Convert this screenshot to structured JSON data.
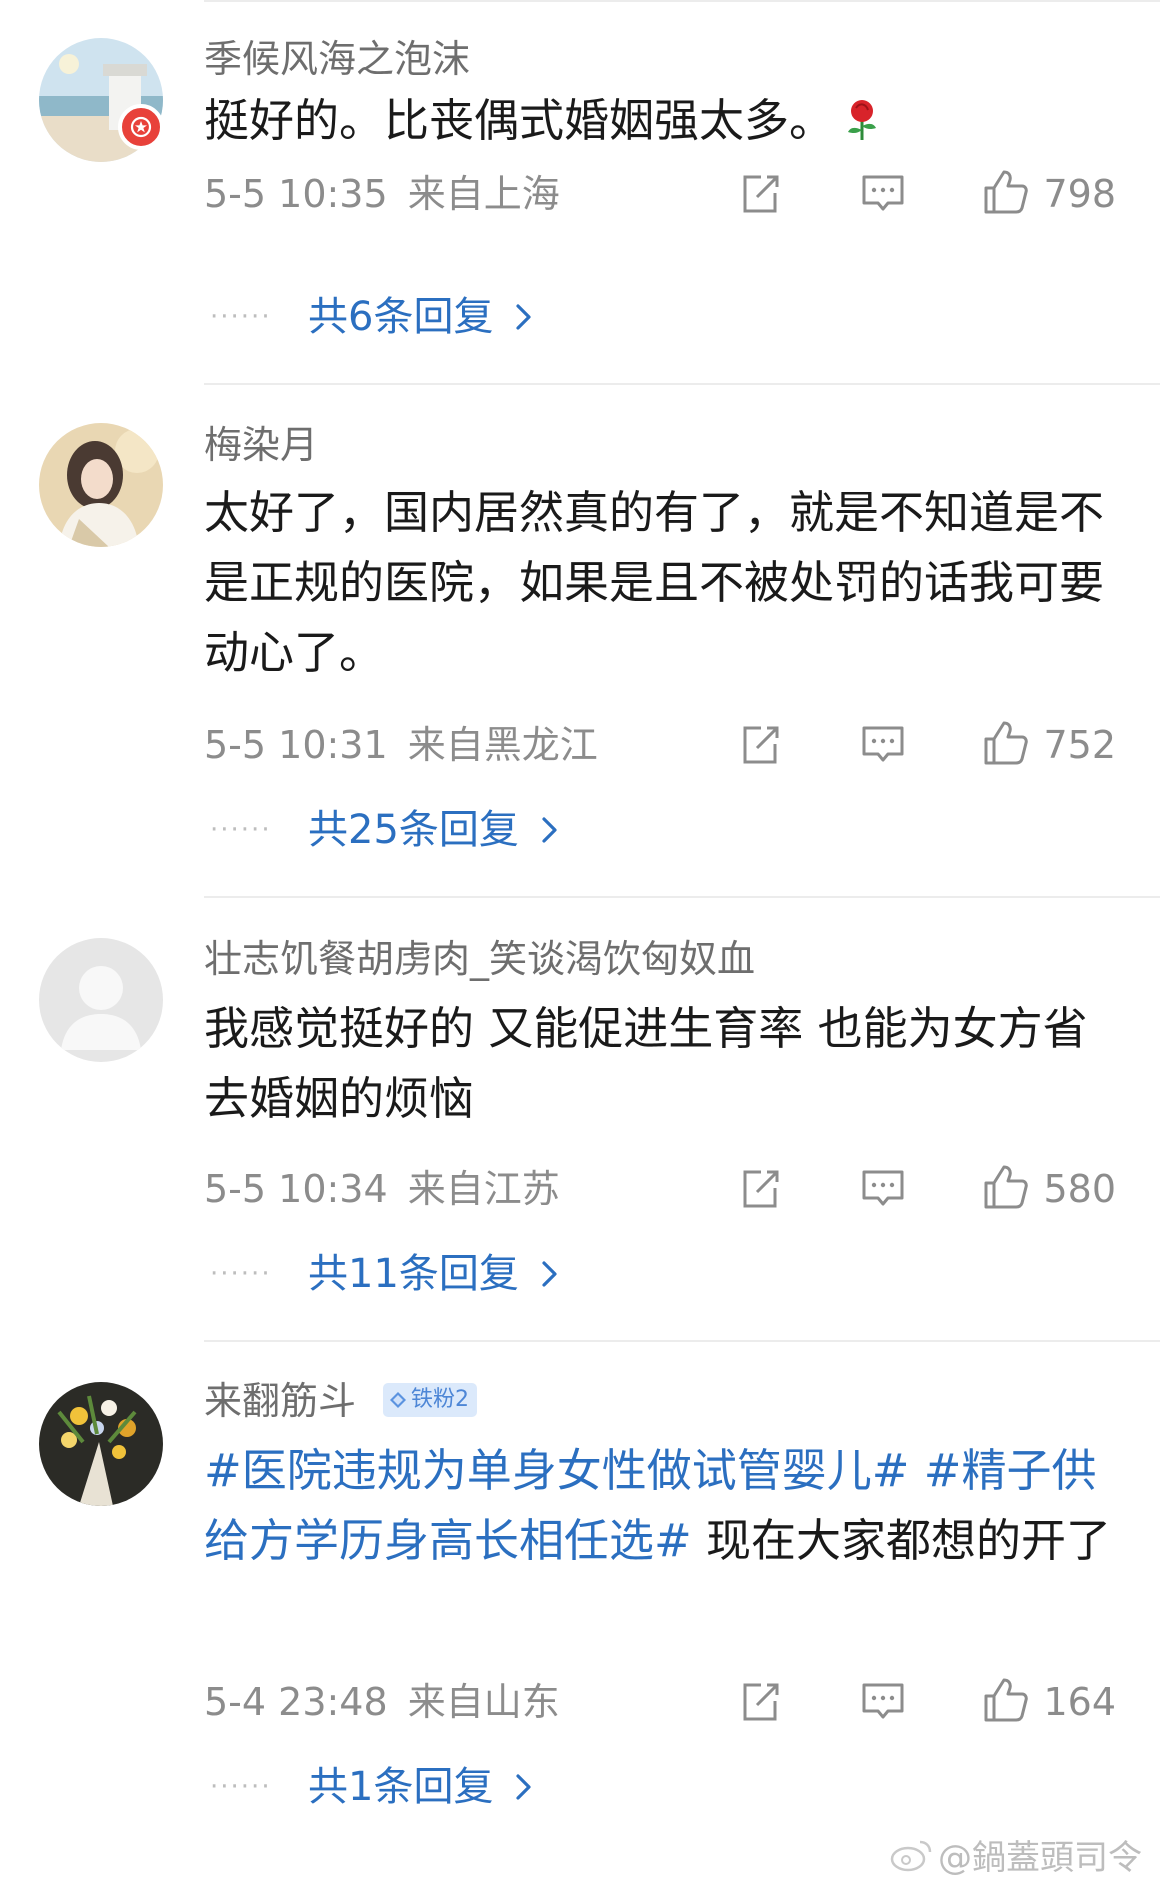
{
  "comments": [
    {
      "username": "季候风海之泡沫",
      "text_parts": [
        {
          "text": "挺好的。比丧偶式婚姻强太多。",
          "type": "text"
        }
      ],
      "emoji": "rose-emoji",
      "time": "5-5 10:35",
      "location": "来自上海",
      "likes": "798",
      "replies": "共6条回复",
      "avatar": "beach-avatar",
      "badge": "red-star-badge"
    },
    {
      "username": "梅染月",
      "text_parts": [
        {
          "text": "太好了，国内居然真的有了，就是不知道是不是正规的医院，如果是且不被处罚的话我可要动心了。",
          "type": "text"
        }
      ],
      "time": "5-5 10:31",
      "location": "来自黑龙江",
      "likes": "752",
      "replies": "共25条回复",
      "avatar": "anime-avatar"
    },
    {
      "username": "壮志饥餐胡虏肉_笑谈渴饮匈奴血",
      "text_parts": [
        {
          "text": "我感觉挺好的 又能促进生育率 也能为女方省去婚姻的烦恼",
          "type": "text"
        }
      ],
      "time": "5-5 10:34",
      "location": "来自江苏",
      "likes": "580",
      "replies": "共11条回复",
      "avatar": "default-avatar"
    },
    {
      "username": "来翻筋斗",
      "fan_badge": "铁粉2",
      "text_parts": [
        {
          "text": "#医院违规为单身女性做试管婴儿#",
          "type": "hashtag"
        },
        {
          "text": " ",
          "type": "text"
        },
        {
          "text": "#精子供给方学历身高长相任选#",
          "type": "hashtag"
        },
        {
          "text": " 现在大家都想的开了",
          "type": "text"
        }
      ],
      "time": "5-4 23:48",
      "location": "来自山东",
      "likes": "164",
      "replies": "共1条回复",
      "avatar": "flowers-avatar"
    }
  ],
  "icons": {
    "share": "share-icon",
    "comment": "comment-icon",
    "like": "thumbs-up-icon",
    "chevron": "chevron-right-icon"
  },
  "colors": {
    "link": "#2b6fc0",
    "meta": "#8c8c8c",
    "username": "#6e6e6e",
    "body": "#1a1a1a",
    "badge_red": "#e8413a"
  },
  "watermark": "@鍋蓋頭司令"
}
